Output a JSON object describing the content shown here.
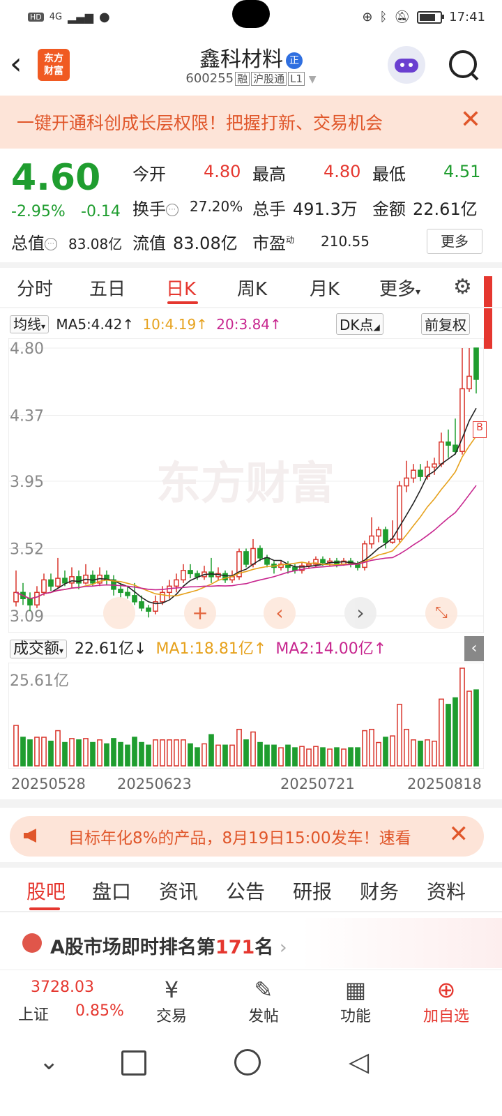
{
  "status_bar": {
    "left_badges": [
      "HD",
      "4G"
    ],
    "time": "17:41"
  },
  "header": {
    "stock_name": "鑫科材料",
    "badge": "正",
    "code": "600255",
    "tags": [
      "融",
      "沪股通",
      "L1"
    ],
    "logo_line1": "东方",
    "logo_line2": "财富"
  },
  "banner": {
    "text": "一键开通科创成长层权限！把握打新、交易机会",
    "close": "✕"
  },
  "quote": {
    "price": "4.60",
    "change_pct": "-2.95%",
    "change": "-0.14",
    "open_label": "今开",
    "open": "4.80",
    "high_label": "最高",
    "high": "4.80",
    "low_label": "最低",
    "low": "4.51",
    "turnover_label": "换手",
    "turnover": "27.20%",
    "volume_label": "总手",
    "volume": "491.3万",
    "amount_label": "金额",
    "amount": "22.61亿",
    "total_cap_label": "总值",
    "total_cap": "83.08亿",
    "float_cap_label": "流值",
    "float_cap": "83.08亿",
    "pe_label": "市盈",
    "pe_sup": "动",
    "pe": "210.55",
    "more": "更多"
  },
  "tabs": [
    "分时",
    "五日",
    "日K",
    "周K",
    "月K",
    "更多"
  ],
  "ma_row": {
    "avg": "均线",
    "ma5": "MA5:4.42",
    "ma10": "10:4.19",
    "ma20": "20:3.84",
    "dk": "DK点",
    "adjust": "前复权"
  },
  "chart_data": {
    "type": "candlestick",
    "y_ticks": [
      "4.80",
      "4.37",
      "3.95",
      "3.52",
      "3.09"
    ],
    "ylim": [
      3.09,
      4.8
    ],
    "watermark": "东方财富",
    "candles": [
      [
        3.18,
        3.24,
        3.38,
        3.15
      ],
      [
        3.24,
        3.2,
        3.3,
        3.16
      ],
      [
        3.2,
        3.16,
        3.24,
        3.12
      ],
      [
        3.16,
        3.24,
        3.28,
        3.14
      ],
      [
        3.24,
        3.32,
        3.36,
        3.22
      ],
      [
        3.32,
        3.28,
        3.36,
        3.25
      ],
      [
        3.28,
        3.33,
        3.46,
        3.27
      ],
      [
        3.33,
        3.3,
        3.38,
        3.28
      ],
      [
        3.3,
        3.34,
        3.4,
        3.27
      ],
      [
        3.34,
        3.3,
        3.38,
        3.26
      ],
      [
        3.3,
        3.35,
        3.42,
        3.29
      ],
      [
        3.35,
        3.3,
        3.38,
        3.28
      ],
      [
        3.3,
        3.35,
        3.4,
        3.28
      ],
      [
        3.35,
        3.32,
        3.38,
        3.29
      ],
      [
        3.32,
        3.26,
        3.35,
        3.22
      ],
      [
        3.26,
        3.24,
        3.3,
        3.2
      ],
      [
        3.24,
        3.22,
        3.28,
        3.2
      ],
      [
        3.22,
        3.18,
        3.3,
        3.16
      ],
      [
        3.18,
        3.14,
        3.22,
        3.12
      ],
      [
        3.14,
        3.12,
        3.16,
        3.08
      ],
      [
        3.12,
        3.18,
        3.22,
        3.1
      ],
      [
        3.18,
        3.24,
        3.28,
        3.16
      ],
      [
        3.24,
        3.28,
        3.32,
        3.2
      ],
      [
        3.28,
        3.32,
        3.36,
        3.24
      ],
      [
        3.32,
        3.38,
        3.42,
        3.3
      ],
      [
        3.38,
        3.36,
        3.42,
        3.33
      ],
      [
        3.36,
        3.34,
        3.38,
        3.32
      ],
      [
        3.34,
        3.37,
        3.41,
        3.32
      ],
      [
        3.37,
        3.34,
        3.46,
        3.3
      ],
      [
        3.34,
        3.36,
        3.4,
        3.32
      ],
      [
        3.36,
        3.32,
        3.38,
        3.3
      ],
      [
        3.32,
        3.34,
        3.38,
        3.3
      ],
      [
        3.34,
        3.5,
        3.52,
        3.32
      ],
      [
        3.5,
        3.42,
        3.52,
        3.4
      ],
      [
        3.42,
        3.52,
        3.58,
        3.4
      ],
      [
        3.52,
        3.46,
        3.54,
        3.44
      ],
      [
        3.46,
        3.42,
        3.48,
        3.4
      ],
      [
        3.42,
        3.4,
        3.44,
        3.36
      ],
      [
        3.4,
        3.42,
        3.44,
        3.38
      ],
      [
        3.42,
        3.4,
        3.44,
        3.36
      ],
      [
        3.4,
        3.38,
        3.42,
        3.36
      ],
      [
        3.38,
        3.41,
        3.43,
        3.36
      ],
      [
        3.41,
        3.42,
        3.44,
        3.39
      ],
      [
        3.42,
        3.45,
        3.47,
        3.4
      ],
      [
        3.45,
        3.43,
        3.47,
        3.41
      ],
      [
        3.43,
        3.44,
        3.46,
        3.41
      ],
      [
        3.44,
        3.42,
        3.46,
        3.4
      ],
      [
        3.42,
        3.44,
        3.46,
        3.41
      ],
      [
        3.44,
        3.42,
        3.46,
        3.4
      ],
      [
        3.42,
        3.4,
        3.44,
        3.38
      ],
      [
        3.4,
        3.55,
        3.57,
        3.38
      ],
      [
        3.55,
        3.6,
        3.72,
        3.52
      ],
      [
        3.6,
        3.64,
        3.66,
        3.56
      ],
      [
        3.64,
        3.56,
        3.66,
        3.52
      ],
      [
        3.56,
        3.58,
        3.7,
        3.55
      ],
      [
        3.58,
        3.92,
        3.95,
        3.56
      ],
      [
        3.92,
        3.97,
        4.08,
        3.88
      ],
      [
        3.97,
        4.02,
        4.06,
        3.94
      ],
      [
        4.02,
        3.98,
        4.06,
        3.95
      ],
      [
        3.98,
        4.04,
        4.08,
        3.96
      ],
      [
        4.04,
        4.06,
        4.1,
        3.99
      ],
      [
        4.06,
        4.2,
        4.26,
        4.04
      ],
      [
        4.2,
        4.18,
        4.28,
        4.1
      ],
      [
        4.18,
        4.14,
        4.35,
        4.12
      ],
      [
        4.14,
        4.54,
        4.8,
        4.12
      ],
      [
        4.54,
        4.62,
        4.8,
        4.52
      ],
      [
        4.8,
        4.6,
        4.8,
        4.51
      ]
    ]
  },
  "volume": {
    "label": "成交额",
    "value": "22.61亿",
    "ma1": "MA1:18.81亿",
    "ma2": "MA2:14.00亿",
    "max_label": "25.61亿",
    "dates": [
      "20250528",
      "20250623",
      "20250721",
      "20250818"
    ]
  },
  "promo": {
    "text": "目标年化8%的产品，8月19日15:00发车！速看",
    "close": "✕"
  },
  "bottom_tabs": [
    "股吧",
    "盘口",
    "资讯",
    "公告",
    "研报",
    "财务",
    "资料"
  ],
  "rank": {
    "prefix": "A股市场即时排名第",
    "rank": "171",
    "suffix": "名"
  },
  "bottom_bar": {
    "index_value": "3728.03",
    "index_name": "上证",
    "index_change": "0.85%",
    "items": [
      "交易",
      "发帖",
      "功能",
      "加自选"
    ]
  }
}
